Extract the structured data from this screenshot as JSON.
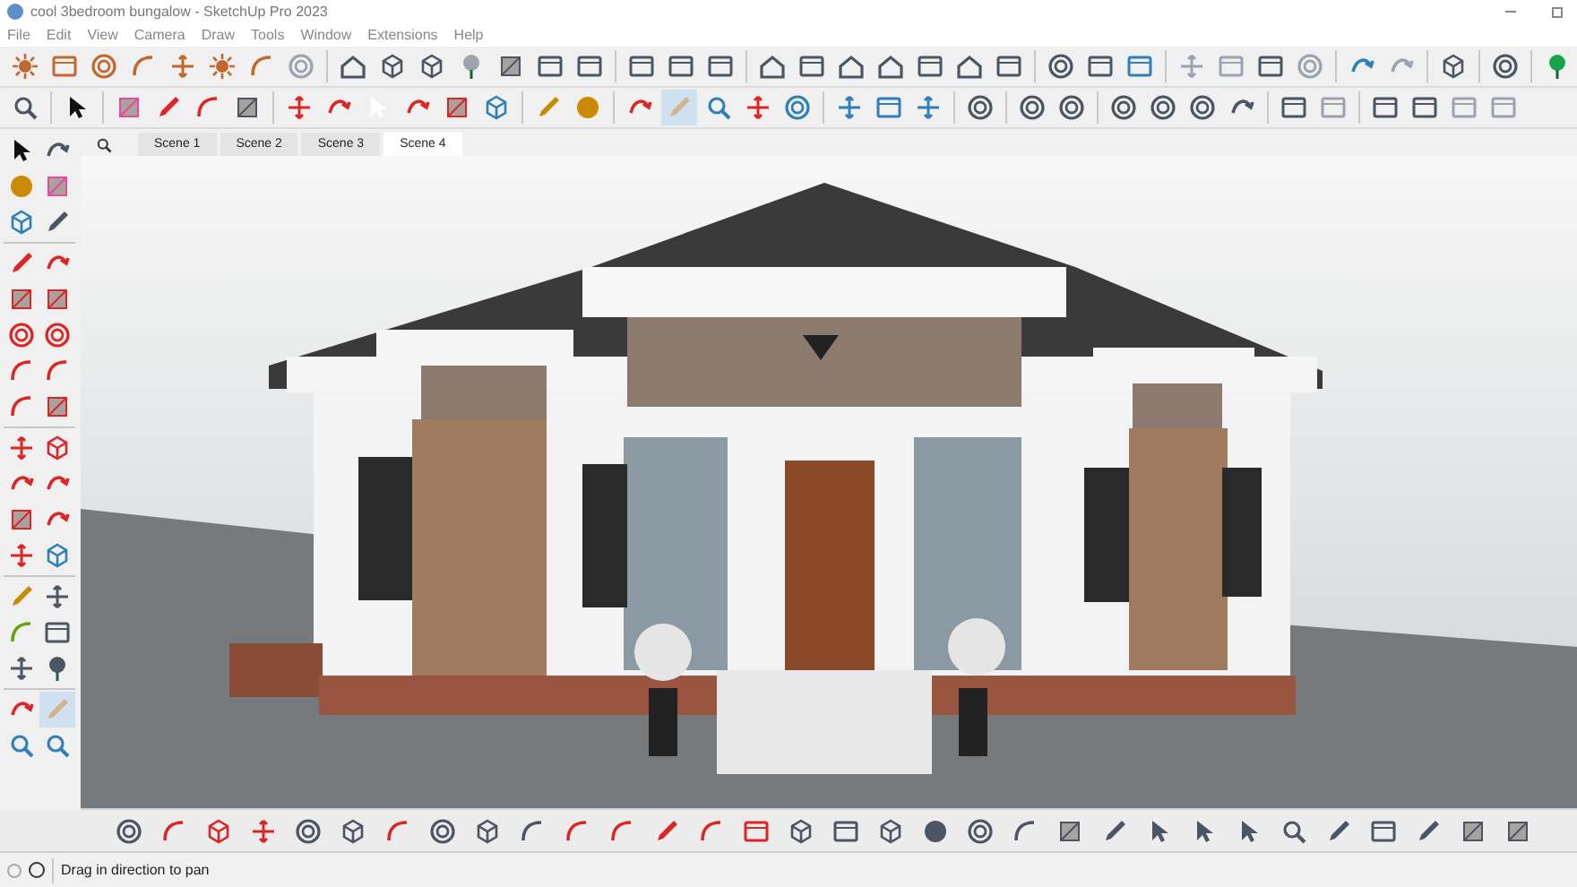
{
  "window": {
    "title": "cool 3bedroom bungalow - SketchUp Pro 2023"
  },
  "menu": [
    "File",
    "Edit",
    "View",
    "Camera",
    "Draw",
    "Tools",
    "Window",
    "Extensions",
    "Help"
  ],
  "scenes": [
    {
      "label": "Scene 1",
      "selected": false
    },
    {
      "label": "Scene 2",
      "selected": false
    },
    {
      "label": "Scene 3",
      "selected": false
    },
    {
      "label": "Scene 4",
      "selected": true
    }
  ],
  "status_bar": {
    "text": "Drag in direction to pan"
  }
}
